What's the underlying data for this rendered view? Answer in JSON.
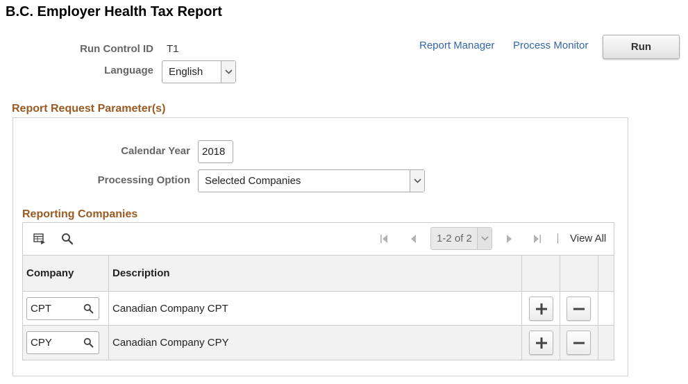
{
  "page": {
    "title": "B.C. Employer Health Tax Report"
  },
  "header": {
    "run_control_label": "Run Control ID",
    "run_control_value": "T1",
    "language_label": "Language",
    "language_value": "English",
    "report_manager_link": "Report Manager",
    "process_monitor_link": "Process Monitor",
    "run_button": "Run"
  },
  "parameters": {
    "section_title": "Report Request Parameter(s)",
    "calendar_year_label": "Calendar Year",
    "calendar_year_value": "2018",
    "processing_option_label": "Processing Option",
    "processing_option_value": "Selected Companies"
  },
  "reporting_companies": {
    "section_title": "Reporting Companies",
    "pager": {
      "range_text": "1-2 of 2",
      "view_all": "View All"
    },
    "columns": [
      "Company",
      "Description"
    ],
    "rows": [
      {
        "company": "CPT",
        "description": "Canadian Company CPT"
      },
      {
        "company": "CPY",
        "description": "Canadian Company CPY"
      }
    ]
  },
  "colors": {
    "section_title": "#9a5a21",
    "link": "#3366aa"
  },
  "icons": {
    "grid_personalize": "grid-personalize-icon",
    "find": "search-icon",
    "first": "first-page-icon",
    "previous": "previous-page-icon",
    "next": "next-page-icon",
    "last": "last-page-icon",
    "lookup": "search-icon",
    "add_row": "plus-icon",
    "delete_row": "minus-icon",
    "dropdown": "chevron-down-icon"
  }
}
